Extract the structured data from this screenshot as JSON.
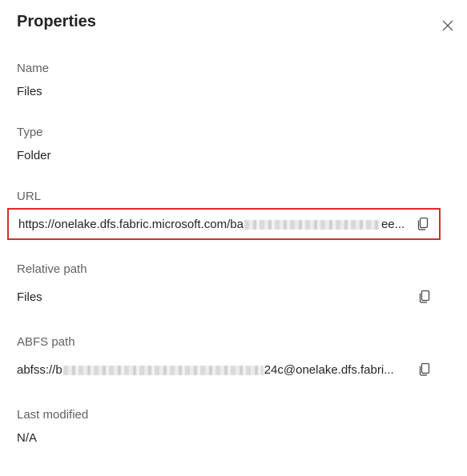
{
  "panel": {
    "title": "Properties"
  },
  "fields": {
    "name": {
      "label": "Name",
      "value": "Files"
    },
    "type": {
      "label": "Type",
      "value": "Folder"
    },
    "url": {
      "label": "URL",
      "value_prefix": "https://onelake.dfs.fabric.microsoft.com/ba",
      "value_suffix": "ee..."
    },
    "relative_path": {
      "label": "Relative path",
      "value": "Files"
    },
    "abfs_path": {
      "label": "ABFS path",
      "value_prefix": "abfss://b",
      "value_suffix": "24c@onelake.dfs.fabri..."
    },
    "last_modified": {
      "label": "Last modified",
      "value": "N/A"
    }
  },
  "colors": {
    "highlight_border": "#d92b2b",
    "label_text": "#616161",
    "value_text": "#242424"
  },
  "icons": {
    "close": "close-icon",
    "copy": "copy-icon"
  }
}
